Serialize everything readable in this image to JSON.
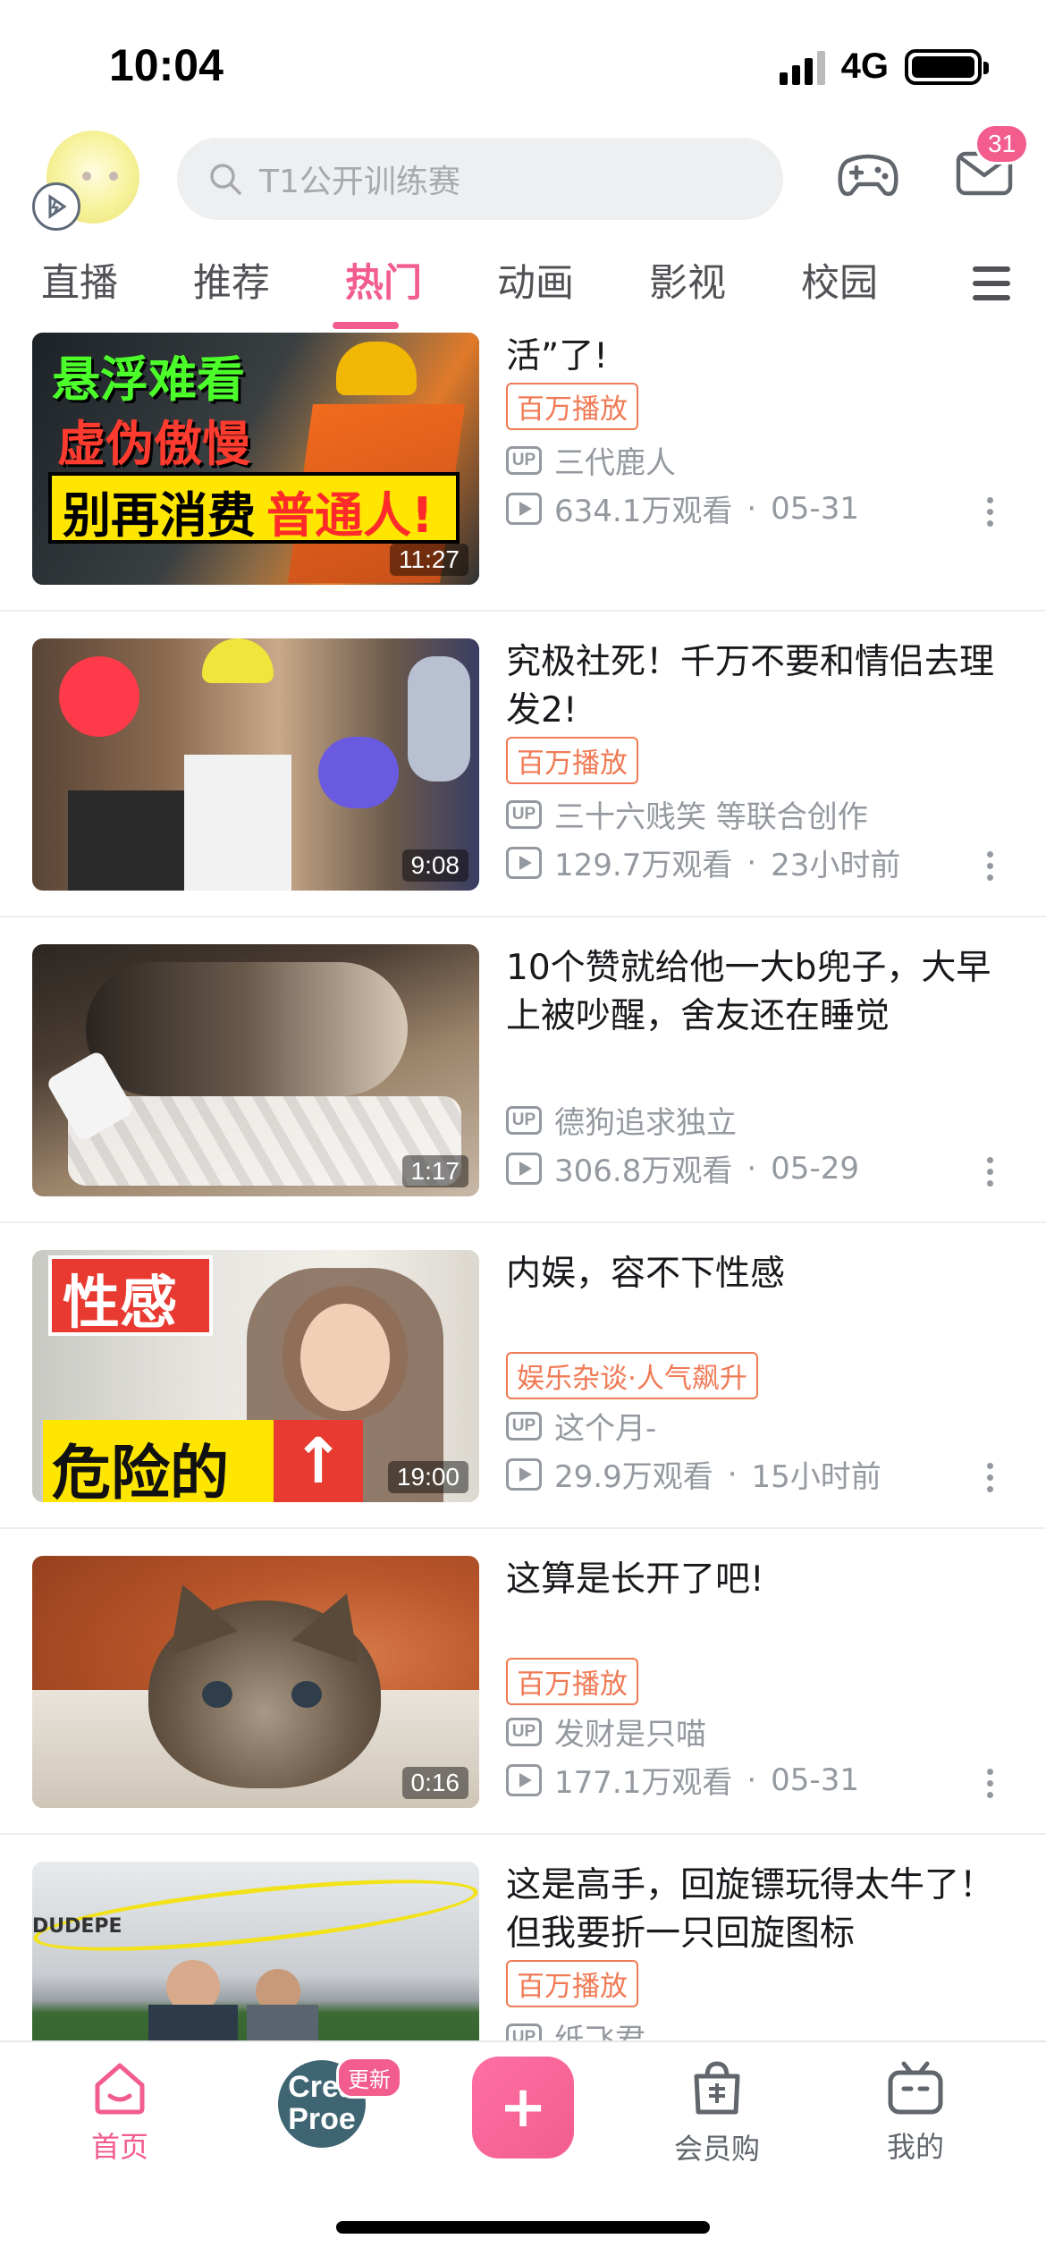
{
  "status": {
    "time": "10:04",
    "network": "4G"
  },
  "header": {
    "search_placeholder": "T1公开训练赛",
    "message_count": "31"
  },
  "tabs": [
    "直播",
    "推荐",
    "热门",
    "动画",
    "影视",
    "校园"
  ],
  "active_tab": "热门",
  "feed": [
    {
      "title": "宋来了？别再让明星“体验生活”了!",
      "tag": "百万播放",
      "author": "三代鹿人",
      "views": "634.1万观看",
      "time": "05-31",
      "duration": "11:27",
      "thumb_text": [
        "悬浮难看",
        "虚伪傲慢",
        "别再消费",
        "普通人!"
      ]
    },
    {
      "title": "究极社死！千万不要和情侣去理发2!",
      "tag": "百万播放",
      "author": "三十六贱笑 等联合创作",
      "views": "129.7万观看",
      "time": "23小时前",
      "duration": "9:08"
    },
    {
      "title": "10个赞就给他一大b兜子，大早上被吵醒，舍友还在睡觉",
      "tag": "",
      "author": "德狗追求独立",
      "views": "306.8万观看",
      "time": "05-29",
      "duration": "1:17"
    },
    {
      "title": "内娱，容不下性感",
      "tag": "娱乐杂谈·人气飙升",
      "author": "这个月-",
      "views": "29.9万观看",
      "time": "15小时前",
      "duration": "19:00",
      "thumb_text": [
        "性感",
        "危险的"
      ]
    },
    {
      "title": "这算是长开了吧!",
      "tag": "百万播放",
      "author": "发财是只喵",
      "views": "177.1万观看",
      "time": "05-31",
      "duration": "0:16"
    },
    {
      "title": "这是高手，回旋镖玩得太牛了！但我要折一只回旋图标",
      "tag": "百万播放",
      "author": "纸飞君",
      "views": "",
      "time": "",
      "duration": "",
      "thumb_text": [
        "DUDEPE"
      ]
    }
  ],
  "labels": {
    "up": "UP",
    "dot": "·"
  },
  "bottom_nav": {
    "home": "首页",
    "creator_badge": "更新",
    "creator_text": [
      "Crea",
      "Proe"
    ],
    "publish": "+",
    "vip_shop": "会员购",
    "mine": "我的"
  },
  "colors": {
    "accent": "#f25d8e",
    "tag": "#f07a55",
    "muted": "#9499a0"
  }
}
